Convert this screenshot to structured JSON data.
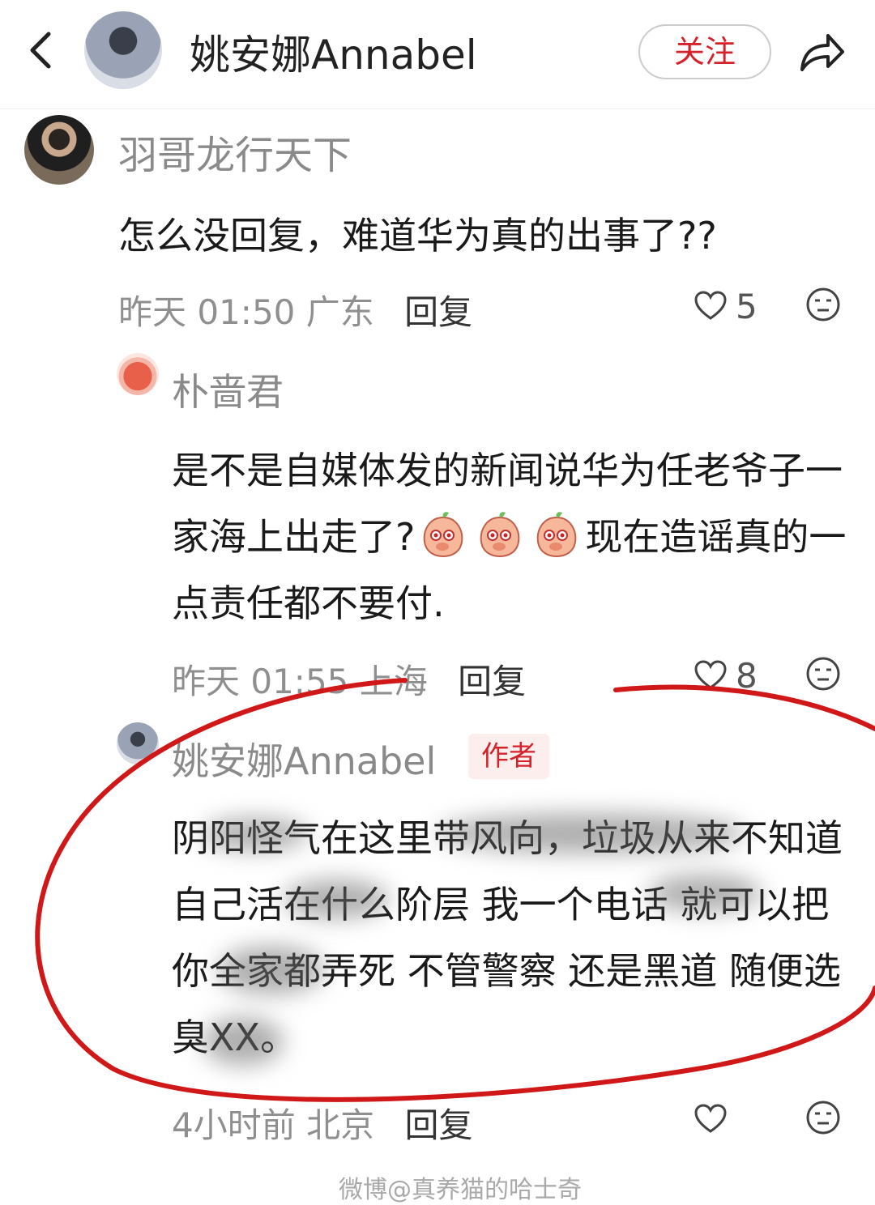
{
  "header": {
    "title": "姚安娜Annabel",
    "follow_label": "关注"
  },
  "comments": [
    {
      "user": "羽哥龙行天下",
      "text": "怎么没回复，难道华为真的出事了??",
      "time": "昨天 01:50",
      "location": "广东",
      "reply_label": "回复",
      "likes": "5"
    },
    {
      "user": "朴啬君",
      "text_before": "是不是自媒体发的新闻说华为任老爷子一家海上出走了?",
      "text_after": "现在造谣真的一点责任都不要付.",
      "time": "昨天 01:55",
      "location": "上海",
      "reply_label": "回复",
      "likes": "8"
    },
    {
      "user": "姚安娜Annabel",
      "badge": "作者",
      "text": "阴阳怪气在这里带风向，垃圾从来不知道自己活在什么阶层 我一个电话 就可以把你全家都弄死 不管警察 还是黑道 随便选 臭XX。",
      "time": "4小时前",
      "location": "北京",
      "reply_label": "回复",
      "likes": ""
    }
  ],
  "icons": {
    "back": "chevron-left-icon",
    "share": "share-arrow-icon",
    "like": "heart-icon",
    "emoji": "neutral-face-icon"
  },
  "watermark": "微博@真养猫的哈士奇",
  "colors": {
    "accent": "#d4222a",
    "annotation": "#d01818"
  }
}
